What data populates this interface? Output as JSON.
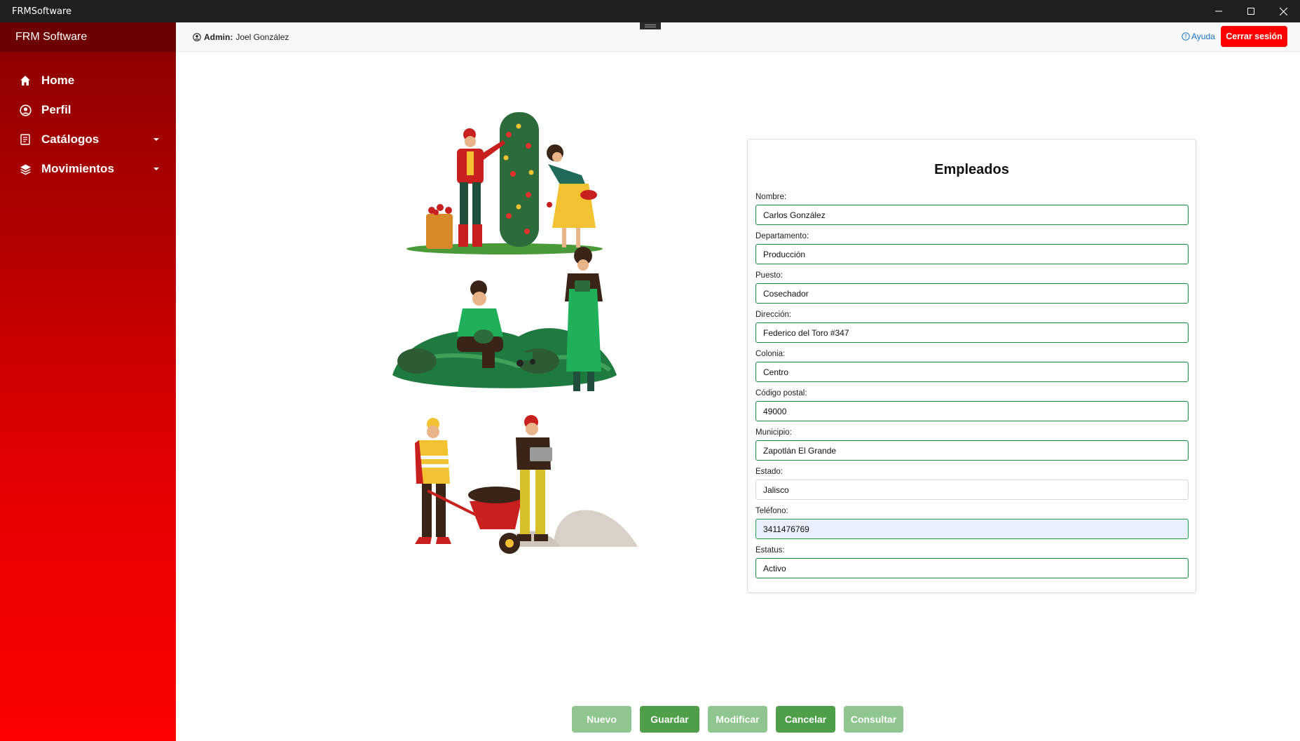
{
  "window": {
    "title": "FRMSoftware"
  },
  "sidebar": {
    "brand": "FRM Software",
    "items": [
      {
        "label": "Home",
        "icon": "home-icon"
      },
      {
        "label": "Perfil",
        "icon": "user-circle-icon"
      },
      {
        "label": "Catálogos",
        "icon": "catalog-icon",
        "has_dropdown": true
      },
      {
        "label": "Movimientos",
        "icon": "layers-icon",
        "has_dropdown": true
      }
    ]
  },
  "header": {
    "admin_label": "Admin:",
    "admin_name": "Joel González",
    "help_label": "Ayuda",
    "logout_label": "Cerrar sesión"
  },
  "form": {
    "title": "Empleados",
    "fields": [
      {
        "label": "Nombre:",
        "value": "Carlos González"
      },
      {
        "label": "Departamento:",
        "value": "Producción"
      },
      {
        "label": "Puesto:",
        "value": "Cosechador"
      },
      {
        "label": "Dirección:",
        "value": "Federico del Toro #347"
      },
      {
        "label": "Colonia:",
        "value": "Centro"
      },
      {
        "label": "Código postal:",
        "value": "49000"
      },
      {
        "label": "Municipio:",
        "value": "Zapotlán El Grande"
      },
      {
        "label": "Estado:",
        "value": "Jalisco"
      },
      {
        "label": "Teléfono:",
        "value": "3411476769"
      },
      {
        "label": "Estatus:",
        "value": "Activo"
      }
    ]
  },
  "actions": {
    "nuevo": "Nuevo",
    "guardar": "Guardar",
    "modificar": "Modificar",
    "cancelar": "Cancelar",
    "consultar": "Consultar"
  },
  "colors": {
    "sidebar_top": "#8a0000",
    "sidebar_bottom": "#ff0000",
    "logout": "#ff0000",
    "input_border": "#198a3a",
    "button_enabled": "#4f9f4a",
    "button_disabled": "#8fc58f"
  }
}
